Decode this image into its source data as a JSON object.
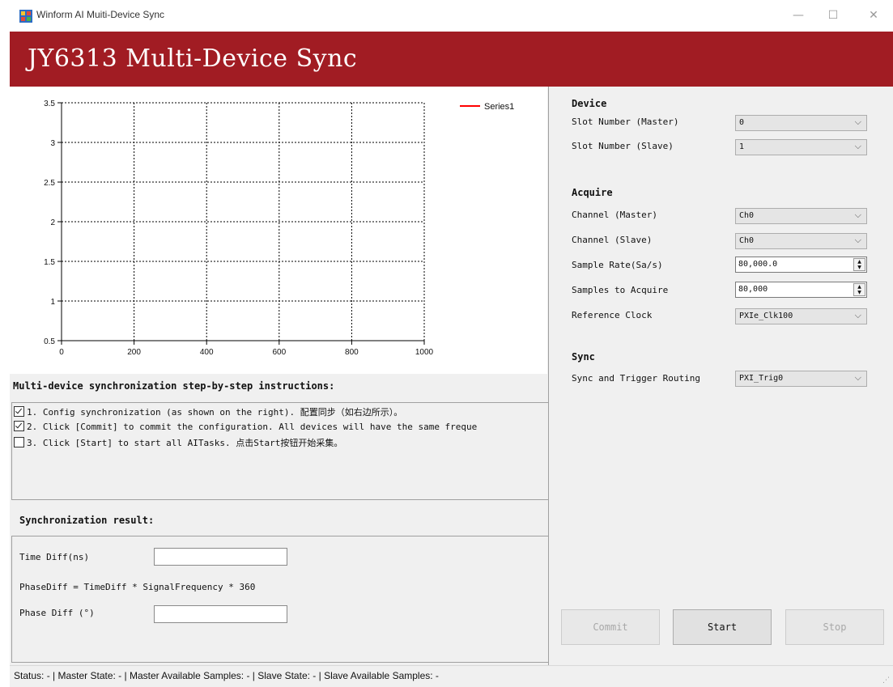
{
  "window": {
    "title": "Winform AI Muiti-Device Sync",
    "controls": {
      "minimize": "—",
      "maximize": "☐",
      "close": "✕"
    }
  },
  "header": {
    "title": "JY6313 Multi-Device Sync",
    "background": "#a11c23"
  },
  "chart_data": {
    "type": "line",
    "series": [
      {
        "name": "Series1",
        "values": [],
        "color": "#ff0000"
      }
    ],
    "x_ticks": [
      "0",
      "200",
      "400",
      "600",
      "800",
      "1000"
    ],
    "y_ticks": [
      "3.5",
      "3",
      "2.5",
      "2",
      "1.5",
      "1",
      "0.5"
    ],
    "xlim": [
      0,
      1000
    ],
    "ylim": [
      0.5,
      3.5
    ],
    "grid": true,
    "legend": "top-right"
  },
  "instructions": {
    "title": "Multi-device synchronization step-by-step instructions:",
    "items": [
      {
        "checked": true,
        "text": "1. Config synchronization (as shown on the right). 配置同步（如右边所示）。"
      },
      {
        "checked": true,
        "text": "2. Click [Commit] to commit the configuration.  All devices will have the same freque"
      },
      {
        "checked": false,
        "text": "3. Click [Start] to start all AITasks. 点击Start按钮开始采集。"
      }
    ]
  },
  "result": {
    "title": "Synchronization result:",
    "time_diff_label": "Time Diff(ns)",
    "time_diff_value": "",
    "formula": "PhaseDiff = TimeDiff * SignalFrequency * 360",
    "phase_diff_label": "Phase Diff (°)",
    "phase_diff_value": ""
  },
  "device": {
    "title": "Device",
    "slot_master_label": "Slot Number (Master)",
    "slot_master_value": "0",
    "slot_slave_label": "Slot Number (Slave)",
    "slot_slave_value": "1"
  },
  "acquire": {
    "title": "Acquire",
    "channel_master_label": "Channel (Master)",
    "channel_master_value": "Ch0",
    "channel_slave_label": "Channel (Slave)",
    "channel_slave_value": "Ch0",
    "sample_rate_label": "Sample Rate(Sa/s)",
    "sample_rate_value": "80,000.0",
    "samples_label": "Samples to Acquire",
    "samples_value": "80,000",
    "ref_clock_label": "Reference Clock",
    "ref_clock_value": "PXIe_Clk100"
  },
  "sync": {
    "title": "Sync",
    "routing_label": "Sync and Trigger Routing",
    "routing_value": "PXI_Trig0"
  },
  "buttons": {
    "commit": "Commit",
    "start": "Start",
    "stop": "Stop"
  },
  "status": {
    "text": "Status: -  |  Master State: -  |  Master Available Samples: -  |  Slave State: -  |  Slave Available Samples: -"
  }
}
